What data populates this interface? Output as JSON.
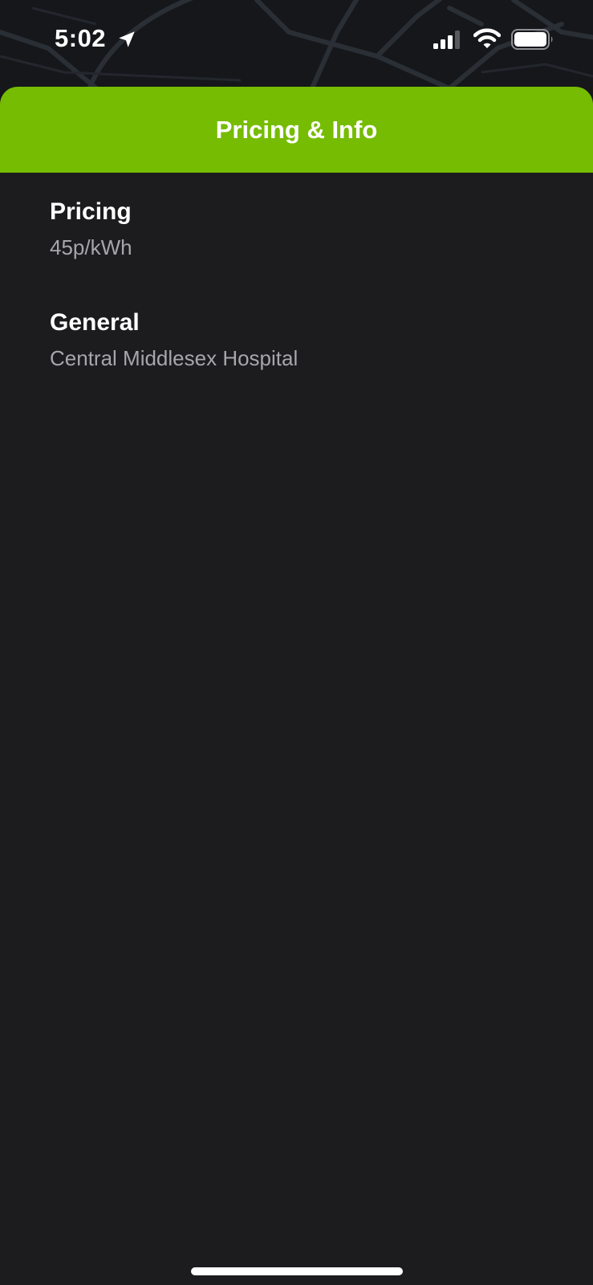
{
  "status_bar": {
    "time": "5:02",
    "icons": [
      "location-arrow-icon",
      "cellular-signal-icon",
      "wifi-icon",
      "battery-icon"
    ]
  },
  "sheet": {
    "title": "Pricing & Info",
    "sections": [
      {
        "label": "Pricing",
        "value": "45p/kWh"
      },
      {
        "label": "General",
        "value": "Central Middlesex Hospital"
      }
    ]
  },
  "colors": {
    "accent": "#76bc03",
    "sheet_background": "#1c1c1e",
    "secondary_text": "#a6a6ab"
  }
}
